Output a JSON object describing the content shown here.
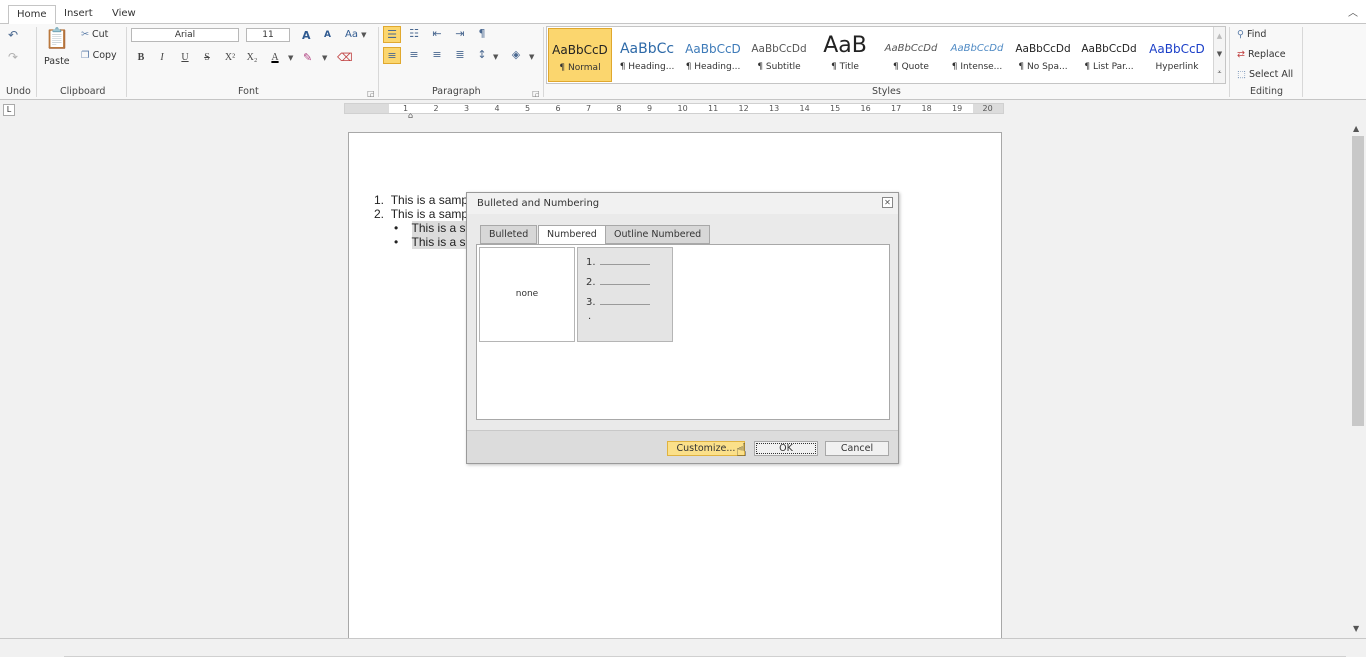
{
  "tabs": [
    {
      "label": "Home",
      "active": true
    },
    {
      "label": "Insert",
      "active": false
    },
    {
      "label": "View",
      "active": false
    }
  ],
  "ribbon": {
    "groups": {
      "undo": "Undo",
      "clipboard": "Clipboard",
      "font": "Font",
      "paragraph": "Paragraph",
      "styles": "Styles",
      "editing": "Editing"
    },
    "clipboard": {
      "paste": "Paste",
      "cut": "Cut",
      "copy": "Copy"
    },
    "font": {
      "name": "Arial",
      "size": "11",
      "grow": "A",
      "shrink": "A",
      "case": "Aa"
    },
    "format_buttons": [
      "B",
      "I",
      "U",
      "S",
      "X²",
      "X₂",
      "A"
    ],
    "styles": [
      {
        "preview": "AaBbCcD",
        "name": "¶ Normal",
        "selected": true
      },
      {
        "preview": "AaBbCc",
        "name": "¶ Heading...",
        "selected": false
      },
      {
        "preview": "AaBbCcD",
        "name": "¶ Heading...",
        "selected": false
      },
      {
        "preview": "AaBbCcDd",
        "name": "¶ Subtitle",
        "selected": false
      },
      {
        "preview": "AaB",
        "name": "¶ Title",
        "selected": false
      },
      {
        "preview": "AaBbCcDd",
        "name": "¶ Quote",
        "selected": false
      },
      {
        "preview": "AaBbCcDd",
        "name": "¶ Intense...",
        "selected": false
      },
      {
        "preview": "AaBbCcDd",
        "name": "¶ No Spa...",
        "selected": false
      },
      {
        "preview": "AaBbCcDd",
        "name": "¶ List Par...",
        "selected": false
      },
      {
        "preview": "AaBbCcD",
        "name": "Hyperlink",
        "selected": false
      }
    ],
    "editing": {
      "find": "Find",
      "replace": "Replace",
      "select_all": "Select All"
    }
  },
  "ruler": {
    "numbers": [
      "1",
      "2",
      "3",
      "4",
      "5",
      "6",
      "7",
      "8",
      "9",
      "10",
      "11",
      "12",
      "13",
      "14",
      "15",
      "16",
      "17",
      "18",
      "19",
      "20"
    ]
  },
  "document": {
    "lines": [
      {
        "marker": "1.",
        "text": "This is a samp"
      },
      {
        "marker": "2.",
        "text": "This is a samp"
      },
      {
        "marker": "•",
        "text": "This is a sa"
      },
      {
        "marker": "•",
        "text": "This is a sa"
      }
    ]
  },
  "dialog": {
    "title": "Bulleted and Numbering",
    "tabs": [
      {
        "label": "Bulleted",
        "active": false
      },
      {
        "label": "Numbered",
        "active": true
      },
      {
        "label": "Outline Numbered",
        "active": false
      }
    ],
    "options": {
      "none_label": "none",
      "numbered_preview": [
        "1.",
        "2.",
        "3."
      ]
    },
    "buttons": {
      "customize": "Customize...",
      "ok": "OK",
      "cancel": "Cancel"
    }
  },
  "colors": {
    "accent": "#fbd66e",
    "accent_border": "#e0a82e",
    "icon_blue": "#5a7ca8"
  }
}
